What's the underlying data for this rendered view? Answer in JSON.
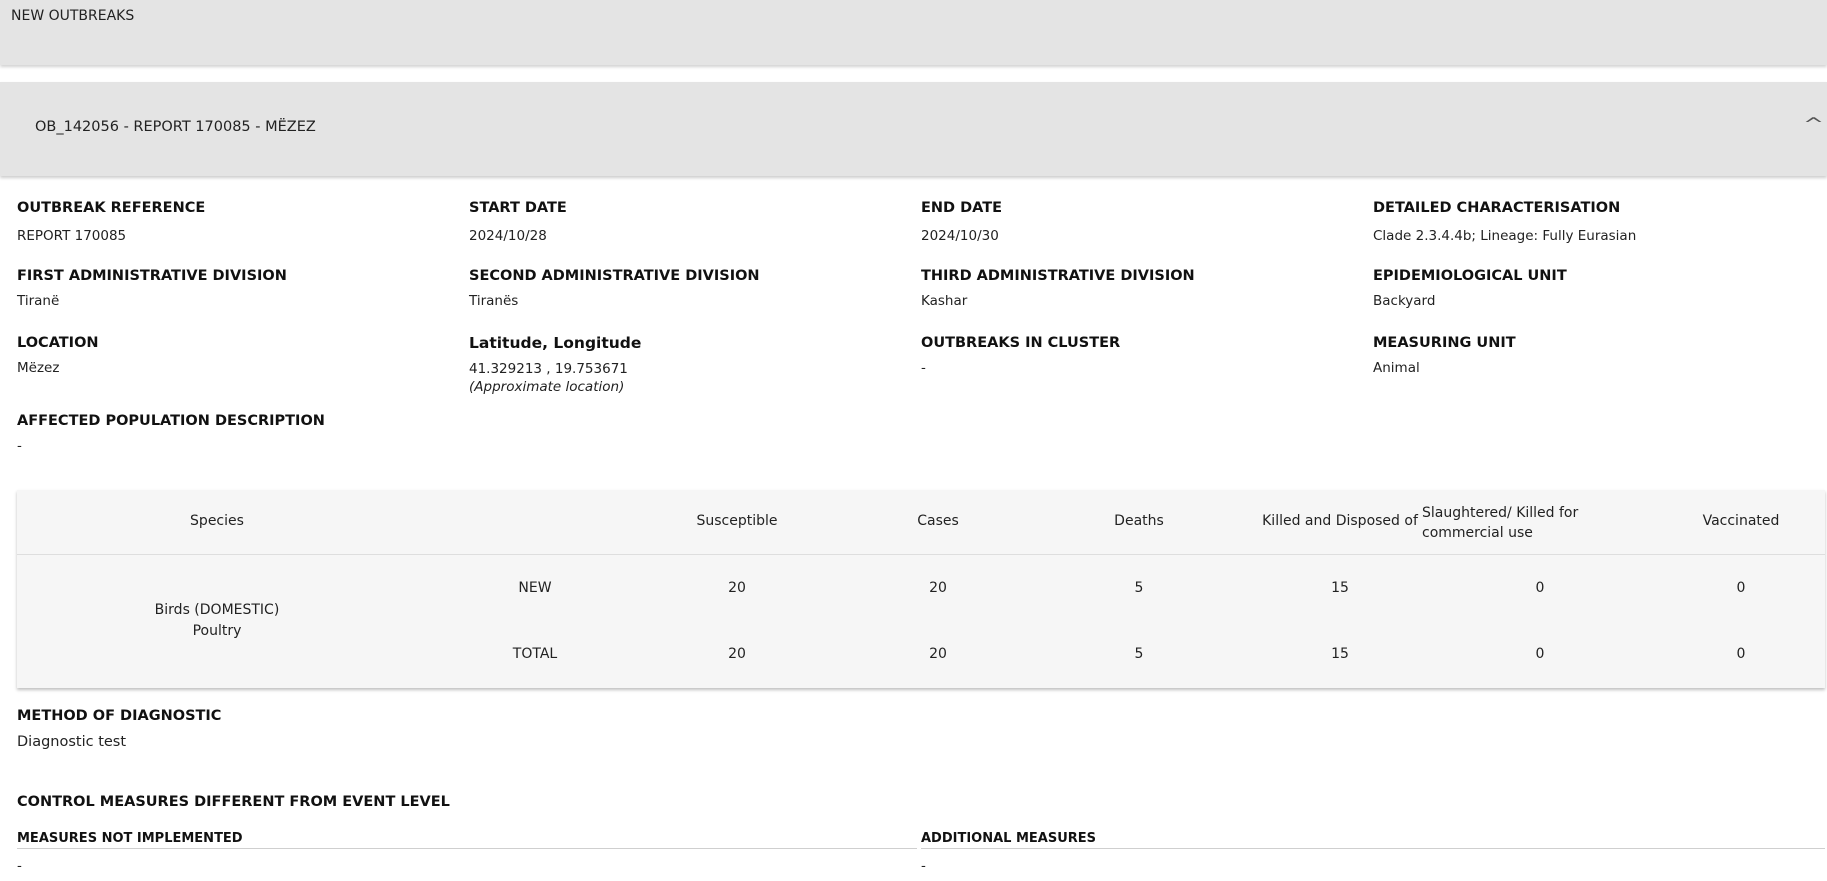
{
  "header": {
    "title": "NEW OUTBREAKS"
  },
  "accordion": {
    "title": "OB_142056 - REPORT 170085 - MËZEZ",
    "toggle_icon": "chevron-up-icon"
  },
  "fields": {
    "outbreak_reference": {
      "label": "OUTBREAK REFERENCE",
      "value": "REPORT 170085"
    },
    "start_date": {
      "label": "START DATE",
      "value": "2024/10/28"
    },
    "end_date": {
      "label": "END DATE",
      "value": "2024/10/30"
    },
    "detailed_characterisation": {
      "label": "DETAILED CHARACTERISATION",
      "value": "Clade 2.3.4.4b; Lineage: Fully Eurasian"
    },
    "first_admin": {
      "label": "FIRST ADMINISTRATIVE DIVISION",
      "value": "Tiranë"
    },
    "second_admin": {
      "label": "SECOND ADMINISTRATIVE DIVISION",
      "value": "Tiranës"
    },
    "third_admin": {
      "label": "THIRD ADMINISTRATIVE DIVISION",
      "value": "Kashar"
    },
    "epi_unit": {
      "label": "EPIDEMIOLOGICAL UNIT",
      "value": "Backyard"
    },
    "location": {
      "label": "LOCATION",
      "value": "Mëzez"
    },
    "lat_long": {
      "label": "Latitude, Longitude",
      "value": "41.329213 , 19.753671",
      "note": "(Approximate location)"
    },
    "outbreaks_in_cluster": {
      "label": "OUTBREAKS IN CLUSTER",
      "value": "-"
    },
    "measuring_unit": {
      "label": "MEASURING UNIT",
      "value": "Animal"
    },
    "affected_population": {
      "label": "AFFECTED POPULATION DESCRIPTION",
      "value": "-"
    }
  },
  "table": {
    "headers": {
      "species": "Species",
      "susceptible": "Susceptible",
      "cases": "Cases",
      "deaths": "Deaths",
      "killed": "Killed and Disposed of",
      "slaughtered": "Slaughtered/ Killed for commercial use",
      "vaccinated": "Vaccinated"
    },
    "species_line1": "Birds (DOMESTIC)",
    "species_line2": "Poultry",
    "rows": [
      {
        "type": "NEW",
        "susceptible": "20",
        "cases": "20",
        "deaths": "5",
        "killed": "15",
        "slaughtered": "0",
        "vaccinated": "0"
      },
      {
        "type": "TOTAL",
        "susceptible": "20",
        "cases": "20",
        "deaths": "5",
        "killed": "15",
        "slaughtered": "0",
        "vaccinated": "0"
      }
    ]
  },
  "diagnostic": {
    "label": "METHOD OF DIAGNOSTIC",
    "value": "Diagnostic test"
  },
  "control": {
    "label": "CONTROL MEASURES DIFFERENT FROM EVENT LEVEL",
    "not_implemented_label": "MEASURES NOT IMPLEMENTED",
    "not_implemented_value": "-",
    "additional_label": "ADDITIONAL MEASURES",
    "additional_value": "-"
  }
}
